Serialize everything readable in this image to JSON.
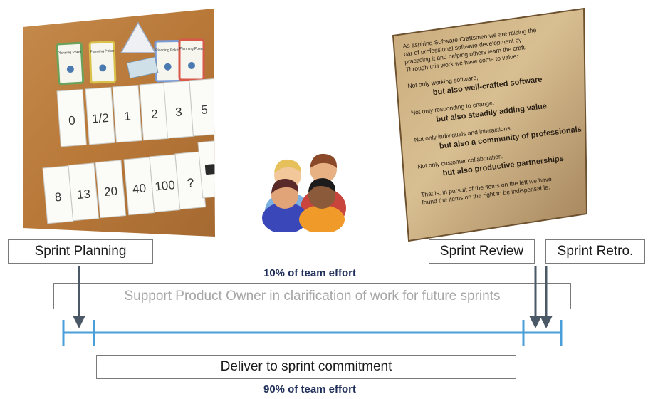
{
  "planning_photo": {
    "header_cards": [
      "Planning Poker",
      "Planning Poker",
      "Planning Poker",
      "Planning Poker"
    ],
    "card_values": [
      "0",
      "1/2",
      "1",
      "2",
      "3",
      "5",
      "8",
      "13",
      "20",
      "40",
      "100",
      "?"
    ],
    "icon": "coffee-cup-icon"
  },
  "people_icon": "team-people-icon",
  "manifesto": {
    "paragraphs": [
      "As aspiring Software Craftsmen we are raising the bar of professional software development by practicing it and helping others learn the craft. Through this work we have come to value:",
      "Not only working software,|but also well-crafted software",
      "Not only responding to change,|but also steadily adding value",
      "Not only individuals and interactions,|but also a community of professionals",
      "Not only customer collaboration,|but also productive partnerships",
      "That is, in pursuit of the items on the left we have found the items on the right to be indispensable."
    ]
  },
  "labels": {
    "sprint_planning": "Sprint Planning",
    "sprint_review": "Sprint Review",
    "sprint_retro": "Sprint Retro.",
    "effort_top": "10% of team effort",
    "support_po": "Support Product Owner in clarification of work for future sprints",
    "deliver": "Deliver to sprint commitment",
    "effort_bottom": "90% of team effort"
  },
  "colors": {
    "timeline": "#4a9fd8",
    "arrow": "#4b5866",
    "effort_text": "#1f2f5a",
    "faded_text": "#a6a6a6"
  }
}
